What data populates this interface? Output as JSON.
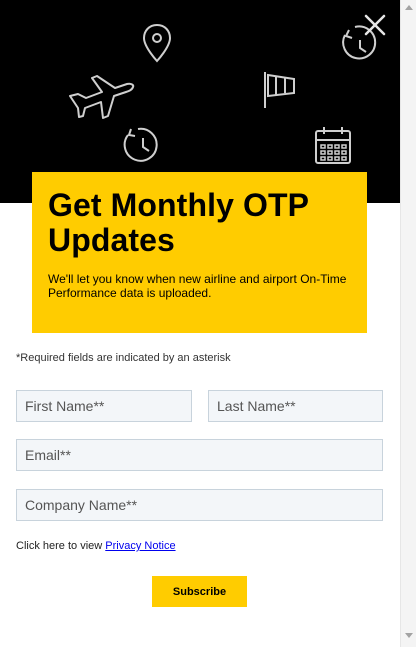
{
  "modal": {
    "title": "Get Monthly OTP Updates",
    "description": "We'll let you know when new airline and airport On-Time Performance data is uploaded.",
    "close_icon": "close-icon"
  },
  "hero": {
    "icons": [
      "location-pin-icon",
      "clock-icon",
      "airplane-icon",
      "windsock-icon",
      "clock-icon",
      "calendar-icon"
    ],
    "line_color": "#b08c1a",
    "background": "#000000"
  },
  "form": {
    "required_note": "*Required fields are indicated by an asterisk",
    "first_name_placeholder": "First Name**",
    "last_name_placeholder": "Last Name**",
    "email_placeholder": "Email**",
    "company_placeholder": "Company Name**",
    "privacy_prefix": "Click here to view",
    "privacy_link": "Privacy Notice",
    "subscribe_label": "Subscribe"
  },
  "colors": {
    "accent": "#ffcc00",
    "field_bg": "#f3f6f9",
    "field_border": "#c8d3dc",
    "link": "#0000ee"
  }
}
